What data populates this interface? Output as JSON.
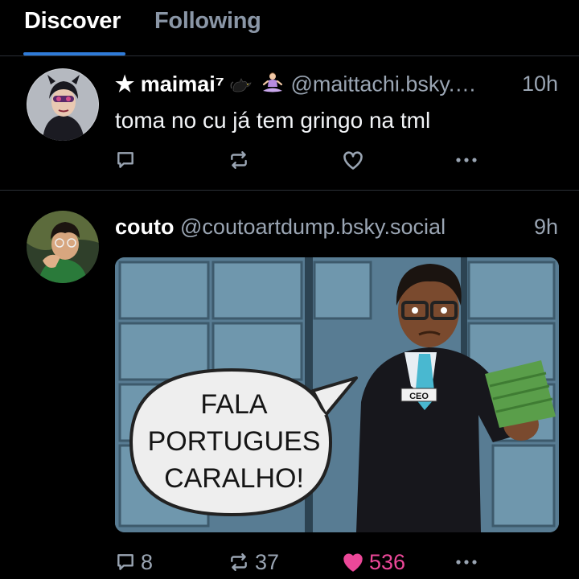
{
  "tabs": [
    {
      "label": "Discover",
      "active": true
    },
    {
      "label": "Following",
      "active": false
    }
  ],
  "colors": {
    "accent": "#2f7bd8",
    "like": "#ec4899",
    "muted": "#9aa5b3"
  },
  "posts": [
    {
      "display_name": "★ maimai⁷",
      "emoji_icons": [
        "black-cat-icon",
        "person-in-lotus-position-icon"
      ],
      "handle": "@maittachi.bsky.…",
      "time": "10h",
      "text": "toma no cu já tem gringo na tml",
      "reply_count": "",
      "repost_count": "",
      "like_count": "",
      "liked": false
    },
    {
      "display_name": "couto",
      "handle": "@coutoartdump.bsky.social",
      "time": "9h",
      "image": {
        "badge_text": "CEO",
        "speech_bubble": [
          "FALA",
          "PORTUGUES",
          "CARALHO!"
        ]
      },
      "reply_count": "8",
      "repost_count": "37",
      "like_count": "536",
      "liked": true
    }
  ]
}
